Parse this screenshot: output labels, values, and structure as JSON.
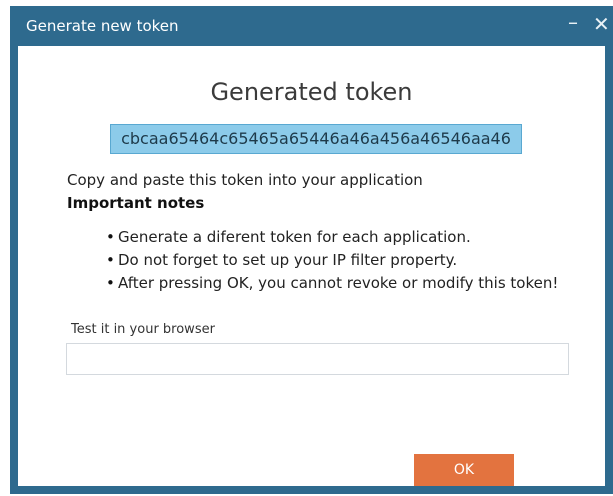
{
  "window": {
    "title": "Generate new token",
    "minimize_icon": "minimize-icon",
    "close_icon": "close-icon"
  },
  "dialog": {
    "heading": "Generated token",
    "token": "cbcaa65464c65465a65446a46a456a46546aa46",
    "instruction": "Copy and paste this token into your application",
    "notes_title": "Important notes",
    "notes": [
      "Generate a diferent token for each application.",
      "Do not forget to set up your IP filter property.",
      "After pressing OK, you cannot revoke or modify this token!"
    ],
    "test_label": "Test it in your browser",
    "test_value": "",
    "ok_label": "OK"
  },
  "colors": {
    "titlebar": "#2e6a8e",
    "token_box": "#8ccbea",
    "ok_button": "#e3733f"
  }
}
